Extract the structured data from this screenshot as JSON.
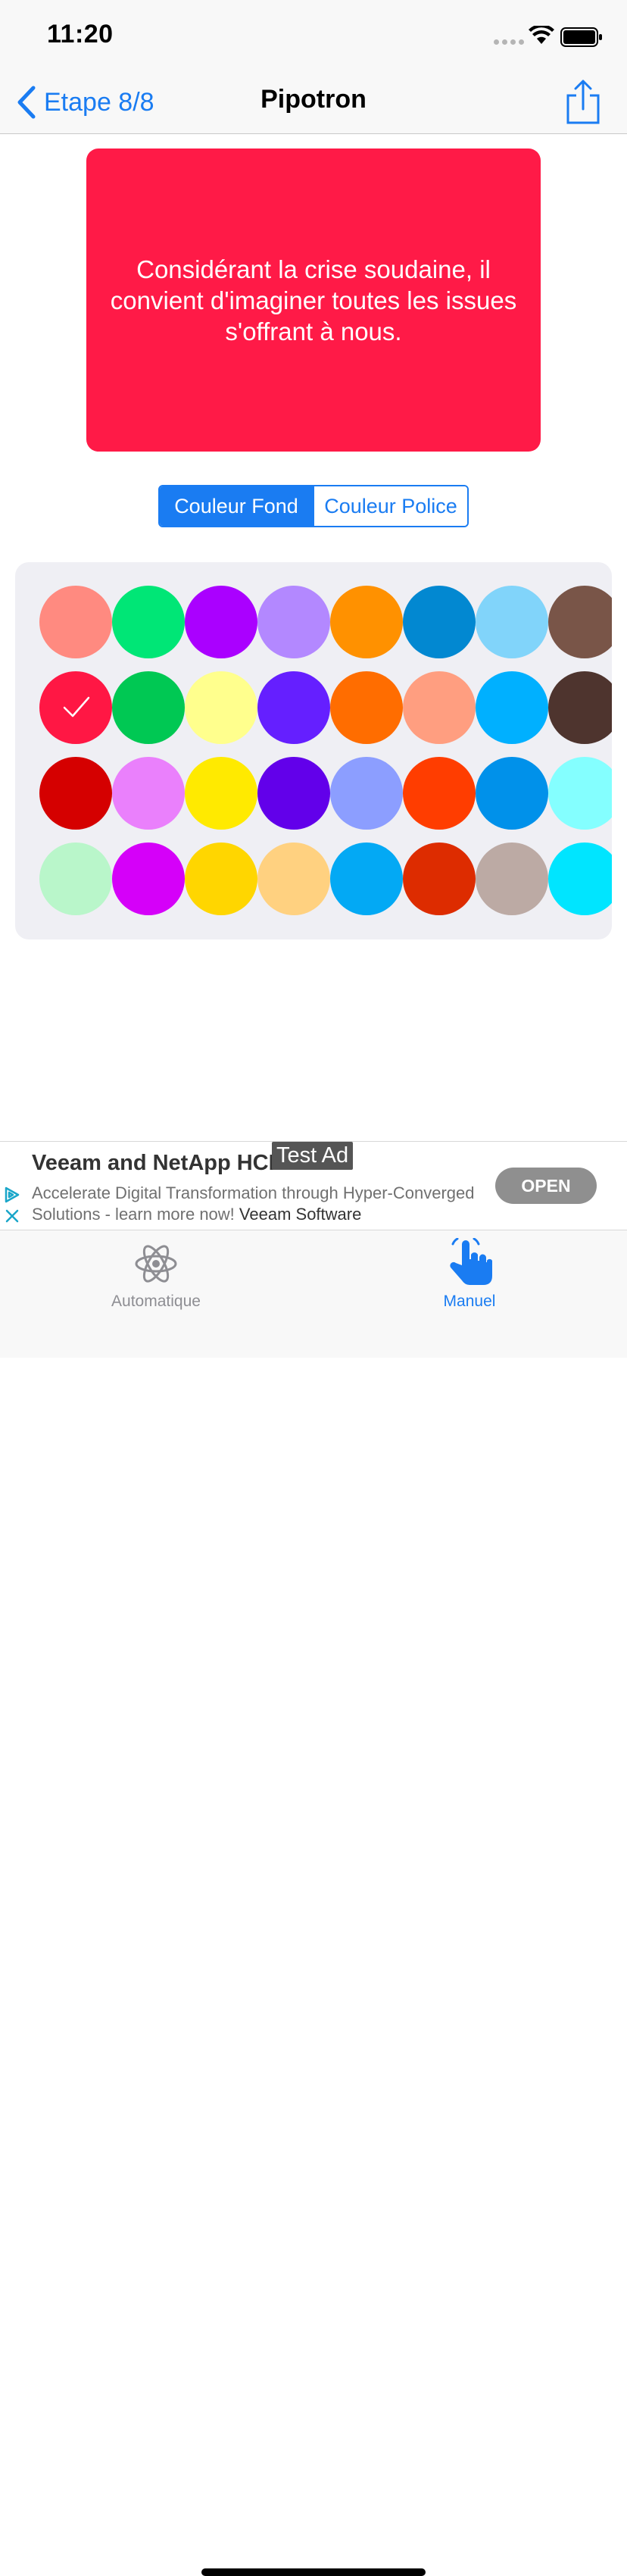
{
  "status_bar": {
    "time": "11:20"
  },
  "nav": {
    "back_label": "Etape 8/8",
    "title": "Pipotron",
    "share_icon": "share-icon"
  },
  "preview": {
    "text": "Considérant la crise soudaine, il convient d'imaginer toutes les issues s'offrant à nous.",
    "background_color": "#ff1a47",
    "text_color": "#ffffff"
  },
  "segmented": {
    "options": [
      "Couleur Fond",
      "Couleur Police"
    ],
    "selected": "Couleur Fond"
  },
  "palette": {
    "selected_index": 8,
    "colors": [
      "#ff8a80",
      "#00e676",
      "#aa00ff",
      "#b388ff",
      "#ff9100",
      "#0288d1",
      "#81d4fa",
      "#795548",
      "#ff1744",
      "#00c853",
      "#ffff8d",
      "#651fff",
      "#ff6d00",
      "#ff9e80",
      "#00b0ff",
      "#4e342e",
      "#d50000",
      "#ea80fc",
      "#ffea00",
      "#6200ea",
      "#8c9eff",
      "#ff3d00",
      "#0091ea",
      "#84ffff",
      "#b9f6ca",
      "#d500f9",
      "#ffd600",
      "#ffd180",
      "#03a9f4",
      "#dd2c00",
      "#bcaaa4",
      "#00e5ff"
    ]
  },
  "ad": {
    "badge": "Test Ad",
    "title": "Veeam and NetApp HCI",
    "description": "Accelerate Digital Transformation through Hyper-Converged Solutions - learn more now!",
    "advertiser": "Veeam Software",
    "cta": "OPEN"
  },
  "tabs": [
    {
      "label": "Automatique",
      "icon": "atom-icon",
      "selected": false
    },
    {
      "label": "Manuel",
      "icon": "hand-pointer-icon",
      "selected": true
    }
  ]
}
